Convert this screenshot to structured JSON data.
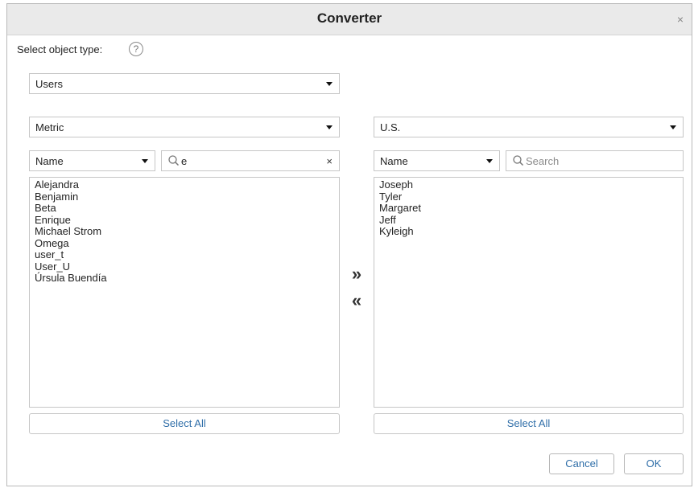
{
  "dialog": {
    "title": "Converter",
    "close_glyph": "×",
    "select_object_type_label": "Select object type:",
    "help_glyph": "?",
    "object_type": "Users"
  },
  "left": {
    "project": "Metric",
    "search_by": "Name",
    "search_value": "e",
    "clear_glyph": "×",
    "items": [
      "Alejandra",
      "Benjamin",
      "Beta",
      "Enrique",
      "Michael Strom",
      "Omega",
      "user_t",
      "User_U",
      "Úrsula Buendía"
    ],
    "select_all": "Select All"
  },
  "transfer": {
    "move_right": "»",
    "move_left": "«"
  },
  "right": {
    "project": "U.S.",
    "search_by": "Name",
    "search_placeholder": "Search",
    "items": [
      "Joseph",
      "Tyler",
      "Margaret",
      "Jeff",
      "Kyleigh"
    ],
    "select_all": "Select All"
  },
  "footer": {
    "cancel": "Cancel",
    "ok": "OK"
  },
  "icons": {
    "search": "search-icon",
    "help": "help-icon",
    "close": "close-icon",
    "caret": "caret-down-icon"
  },
  "colors": {
    "link_blue": "#2f6ea8",
    "title_bar": "#eaeaea",
    "border": "#c6c6c6"
  }
}
